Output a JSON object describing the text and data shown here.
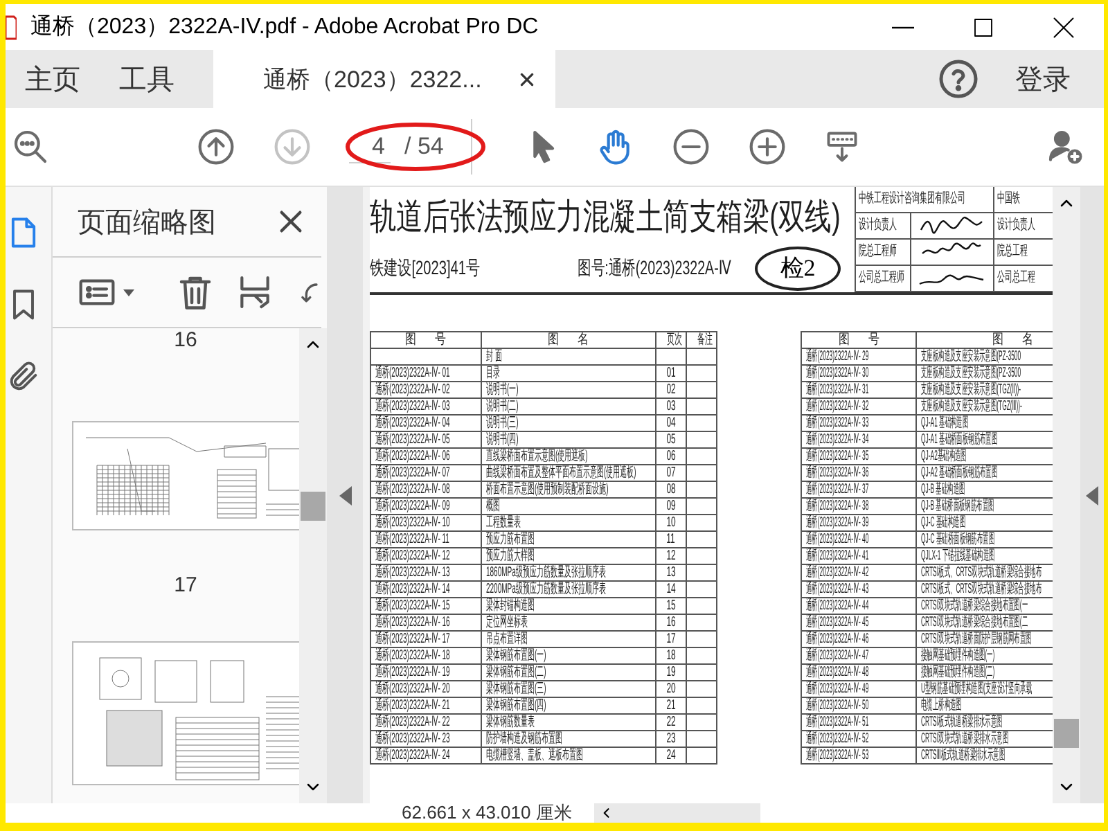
{
  "window": {
    "title": "通桥（2023）2322A-IV.pdf - Adobe Acrobat Pro DC"
  },
  "tabs": [
    {
      "label": "主页",
      "selected": false
    },
    {
      "label": "工具",
      "selected": false
    },
    {
      "label": "通桥（2023）2322...",
      "selected": true
    }
  ],
  "account": {
    "label": "登录"
  },
  "toolbar": [
    {
      "kind": "find",
      "selected": false,
      "disabled": false
    },
    {
      "kind": "previous_page",
      "selected": false,
      "disabled": false
    },
    {
      "kind": "next_page",
      "selected": false,
      "disabled": true
    },
    {
      "kind": "page",
      "value": "4",
      "total": "/ 54"
    },
    {
      "kind": "select",
      "selected": false,
      "disabled": false
    },
    {
      "kind": "hand",
      "selected": true,
      "disabled": false
    },
    {
      "kind": "zoom_out",
      "selected": false,
      "disabled": false
    },
    {
      "kind": "zoom_in",
      "selected": false,
      "disabled": false
    },
    {
      "kind": "scroll_mode",
      "selected": false,
      "disabled": false
    },
    {
      "kind": "share",
      "selected": false,
      "disabled": false
    }
  ],
  "side_rail": [
    {
      "kind": "pages",
      "selected": true
    },
    {
      "kind": "bookmarks",
      "selected": false
    },
    {
      "kind": "attachments",
      "selected": false
    }
  ],
  "thumbnail_panel": {
    "title": "页面缩略图",
    "items": [
      {
        "kind": "label",
        "text": "16"
      },
      {
        "kind": "thumbnail"
      },
      {
        "kind": "label",
        "text": "17"
      },
      {
        "kind": "thumbnail"
      }
    ]
  },
  "document": {
    "title": "轨道后张法预应力混凝土简支箱梁(双线)",
    "ref": "铁建设[2023]41号",
    "drawing_no": "图号:通桥(2023)2322A-Ⅳ",
    "stamp": "检2",
    "title_block": [
      {
        "kind": "company",
        "left": "中铁工程设计咨询集团有限公司",
        "right": "中国铁"
      },
      {
        "kind": "signature",
        "left": "设计负责人",
        "right": "设计负责人"
      },
      {
        "kind": "signature",
        "left": "院总工程师",
        "right": "院总工程"
      },
      {
        "kind": "signature",
        "left": "公司总工程师",
        "right": "公司总工程"
      }
    ],
    "tables": [
      {
        "columns": [
          "图 号",
          "图 名",
          "页次",
          "备注"
        ],
        "rows": [
          {
            "name": "封 面"
          },
          {
            "code": "通桥(2023)2322A-Ⅳ- 01",
            "name": "目录",
            "page": "01"
          },
          {
            "code": "通桥(2023)2322A-Ⅳ- 02",
            "name": "说明书(一)",
            "page": "02"
          },
          {
            "code": "通桥(2023)2322A-Ⅳ- 03",
            "name": "说明书(二)",
            "page": "03"
          },
          {
            "code": "通桥(2023)2322A-Ⅳ- 04",
            "name": "说明书(三)",
            "page": "04"
          },
          {
            "code": "通桥(2023)2322A-Ⅳ- 05",
            "name": "说明书(四)",
            "page": "05"
          },
          {
            "code": "通桥(2023)2322A-Ⅳ- 06",
            "name": "直线梁桥面布置示意图(使用遮板)",
            "page": "06"
          },
          {
            "code": "通桥(2023)2322A-Ⅳ- 07",
            "name": "曲线梁桥面布置及整体平面布置示意图(使用遮板)",
            "page": "07"
          },
          {
            "code": "通桥(2023)2322A-Ⅳ- 08",
            "name": "桥面布置示意图(使用预制装配桥面设施)",
            "page": "08"
          },
          {
            "code": "通桥(2023)2322A-Ⅳ- 09",
            "name": "概图",
            "page": "09"
          },
          {
            "code": "通桥(2023)2322A-Ⅳ- 10",
            "name": "工程数量表",
            "page": "10"
          },
          {
            "code": "通桥(2023)2322A-Ⅳ- 11",
            "name": "预应力筋布置图",
            "page": "11"
          },
          {
            "code": "通桥(2023)2322A-Ⅳ- 12",
            "name": "预应力筋大样图",
            "page": "12"
          },
          {
            "code": "通桥(2023)2322A-Ⅳ- 13",
            "name": "1860MPa级预应力筋数量及张拉顺序表",
            "page": "13"
          },
          {
            "code": "通桥(2023)2322A-Ⅳ- 14",
            "name": "2200MPa级预应力筋数量及张拉顺序表",
            "page": "14"
          },
          {
            "code": "通桥(2023)2322A-Ⅳ- 15",
            "name": "梁体封锚构造图",
            "page": "15"
          },
          {
            "code": "通桥(2023)2322A-Ⅳ- 16",
            "name": "定位网坐标表",
            "page": "16"
          },
          {
            "code": "通桥(2023)2322A-Ⅳ- 17",
            "name": "吊点布置详图",
            "page": "17"
          },
          {
            "code": "通桥(2023)2322A-Ⅳ- 18",
            "name": "梁体钢筋布置图(一)",
            "page": "18"
          },
          {
            "code": "通桥(2023)2322A-Ⅳ- 19",
            "name": "梁体钢筋布置图(二)",
            "page": "19"
          },
          {
            "code": "通桥(2023)2322A-Ⅳ- 20",
            "name": "梁体钢筋布置图(三)",
            "page": "20"
          },
          {
            "code": "通桥(2023)2322A-Ⅳ- 21",
            "name": "梁体钢筋布置图(四)",
            "page": "21"
          },
          {
            "code": "通桥(2023)2322A-Ⅳ- 22",
            "name": "梁体钢筋数量表",
            "page": "22"
          },
          {
            "code": "通桥(2023)2322A-Ⅳ- 23",
            "name": "防护墙构造及钢筋布置图",
            "page": "23"
          },
          {
            "code": "通桥(2023)2322A-Ⅳ- 24",
            "name": "电缆槽竖墙、盖板、遮板布置图",
            "page": "24"
          }
        ]
      },
      {
        "columns": [
          "图 号",
          "图 名"
        ],
        "rows": [
          {
            "code": "通桥(2023)2322A-Ⅳ- 29",
            "name": "支座板构造及支座安装示意图(PZ-3500"
          },
          {
            "code": "通桥(2023)2322A-Ⅳ- 30",
            "name": "支座板构造及支座安装示意图(PZ-3500"
          },
          {
            "code": "通桥(2023)2322A-Ⅳ- 31",
            "name": "支座板构造及支座安装示意图(TGZ(Ⅱ))-"
          },
          {
            "code": "通桥(2023)2322A-Ⅳ- 32",
            "name": "支座板构造及支座安装示意图(TGZ(Ⅲ))-"
          },
          {
            "code": "通桥(2023)2322A-Ⅳ- 33",
            "name": "QJ-A1 基础构造图"
          },
          {
            "code": "通桥(2023)2322A-Ⅳ- 34",
            "name": "QJ-A1 基础桥面板钢筋布置图"
          },
          {
            "code": "通桥(2023)2322A-Ⅳ- 35",
            "name": "QJ-A2基础构造图"
          },
          {
            "code": "通桥(2023)2322A-Ⅳ- 36",
            "name": "QJ-A2 基础桥面板钢筋布置图"
          },
          {
            "code": "通桥(2023)2322A-Ⅳ- 37",
            "name": "QJ-B 基础构造图"
          },
          {
            "code": "通桥(2023)2322A-Ⅳ- 38",
            "name": "QJ-B 基础桥面板钢筋布置图"
          },
          {
            "code": "通桥(2023)2322A-Ⅳ- 39",
            "name": "QJ-C 基础构造图"
          },
          {
            "code": "通桥(2023)2322A-Ⅳ- 40",
            "name": "QJ-C 基础桥面板钢筋布置图"
          },
          {
            "code": "通桥(2023)2322A-Ⅳ- 41",
            "name": "QJLX-1 下锚拉线基础构造图"
          },
          {
            "code": "通桥(2023)2322A-Ⅳ- 42",
            "name": "CRTSⅠ板式、CRTS双块式轨道桥梁综合接地布"
          },
          {
            "code": "通桥(2023)2322A-Ⅳ- 43",
            "name": "CRTSⅠ板式、CRTS双块式轨道桥梁综合接地布"
          },
          {
            "code": "通桥(2023)2322A-Ⅳ- 44",
            "name": "CRTSⅠ双块式轨道桥梁综合接地布置图(一"
          },
          {
            "code": "通桥(2023)2322A-Ⅳ- 45",
            "name": "CRTSⅠ双块式轨道桥梁综合接地布置图(二"
          },
          {
            "code": "通桥(2023)2322A-Ⅳ- 46",
            "name": "CRTSⅠ双块式轨道桥面防护层钢筋网布置图"
          },
          {
            "code": "通桥(2023)2322A-Ⅳ- 47",
            "name": "接触网基础预埋件构造图(一)"
          },
          {
            "code": "通桥(2023)2322A-Ⅳ- 48",
            "name": "接触网基础预埋件构造图(二)"
          },
          {
            "code": "通桥(2023)2322A-Ⅳ- 49",
            "name": "U型钢筋基础预埋构造图(支座设计竖向承载"
          },
          {
            "code": "通桥(2023)2322A-Ⅳ- 50",
            "name": "电缆上桥构造图"
          },
          {
            "code": "通桥(2023)2322A-Ⅳ- 51",
            "name": "CRTSⅠ板式轨道桥梁排水示意图"
          },
          {
            "code": "通桥(2023)2322A-Ⅳ- 52",
            "name": "CRTSⅠ双块式轨道桥梁排水示意图"
          },
          {
            "code": "通桥(2023)2322A-Ⅳ- 53",
            "name": "CRTSⅢ板式轨道桥梁排水示意图"
          }
        ]
      }
    ]
  },
  "status": {
    "size": "62.661 x 43.010 厘米"
  }
}
